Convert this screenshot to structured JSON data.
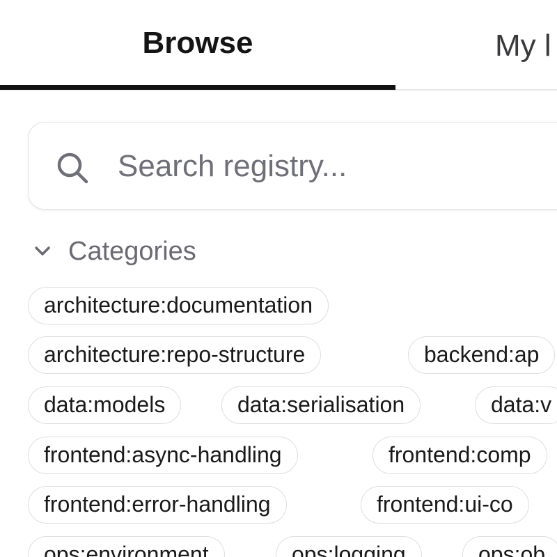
{
  "tabs": [
    {
      "label": "Browse",
      "active": true
    },
    {
      "label": "My l",
      "active": false
    }
  ],
  "search": {
    "placeholder": "Search registry...",
    "value": "",
    "icon": "search-icon"
  },
  "categories": {
    "title": "Categories",
    "expanded": true,
    "chevron": "chevron-down-icon",
    "items": [
      "architecture:documentation",
      "architecture:repo-structure",
      "backend:ap",
      "data:models",
      "data:serialisation",
      "data:v",
      "frontend:async-handling",
      "frontend:comp",
      "frontend:error-handling",
      "frontend:ui-co",
      "ops:environment",
      "ops:logging",
      "ops:ob"
    ]
  },
  "colors": {
    "accent": "#121212",
    "muted_text": "#6a6a72",
    "border": "#dedee2"
  }
}
